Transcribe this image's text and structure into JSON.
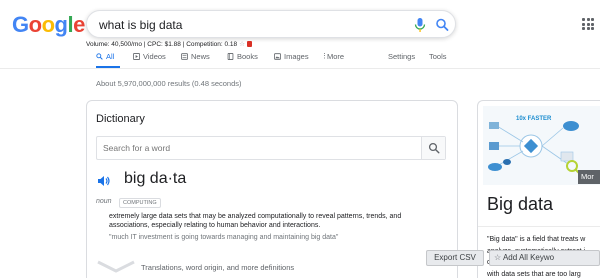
{
  "logo": {
    "text": "Google",
    "colors": [
      "#4285F4",
      "#EA4335",
      "#FBBC05",
      "#4285F4",
      "#34A853",
      "#EA4335"
    ]
  },
  "search": {
    "query": "what is big data"
  },
  "keyword_stats": {
    "text": "Volume: 40,500/mo | CPC: $1.88 | Competition: 0.18",
    "star": "☆"
  },
  "tabs": [
    {
      "label": "All",
      "active": true
    },
    {
      "label": "Videos"
    },
    {
      "label": "News"
    },
    {
      "label": "Books"
    },
    {
      "label": "Images"
    },
    {
      "label": "More"
    },
    {
      "label": "Settings"
    },
    {
      "label": "Tools"
    }
  ],
  "result_stats": "About 5,970,000,000 results (0.48 seconds)",
  "dictionary": {
    "title": "Dictionary",
    "search_placeholder": "Search for a word",
    "word": "big da·ta",
    "part_of_speech": "noun",
    "label": "COMPUTING",
    "definition": "extremely large data sets that may be analyzed computationally to reveal patterns, trends, and associations, especially relating to human behavior and interactions.",
    "example": "\"much IT investment is going towards managing and maintaining big data\"",
    "more_info": "Translations, word origin, and more definitions"
  },
  "knowledge_panel": {
    "image_text": "10x FASTER",
    "more_label": "Mor",
    "title": "Big data",
    "description_lines": [
      "\"Big data\" is a field that treats w",
      "analyze, systematically extract i",
      "deal with data sets that are too",
      "with data sets that are too larg"
    ]
  },
  "overlays": {
    "export_csv": "Export CSV",
    "add_all_keywords": "Add All Keywo",
    "add_star": "☆"
  },
  "colors": {
    "accent": "#1a73e8",
    "text": "#202124",
    "muted": "#70757a"
  }
}
